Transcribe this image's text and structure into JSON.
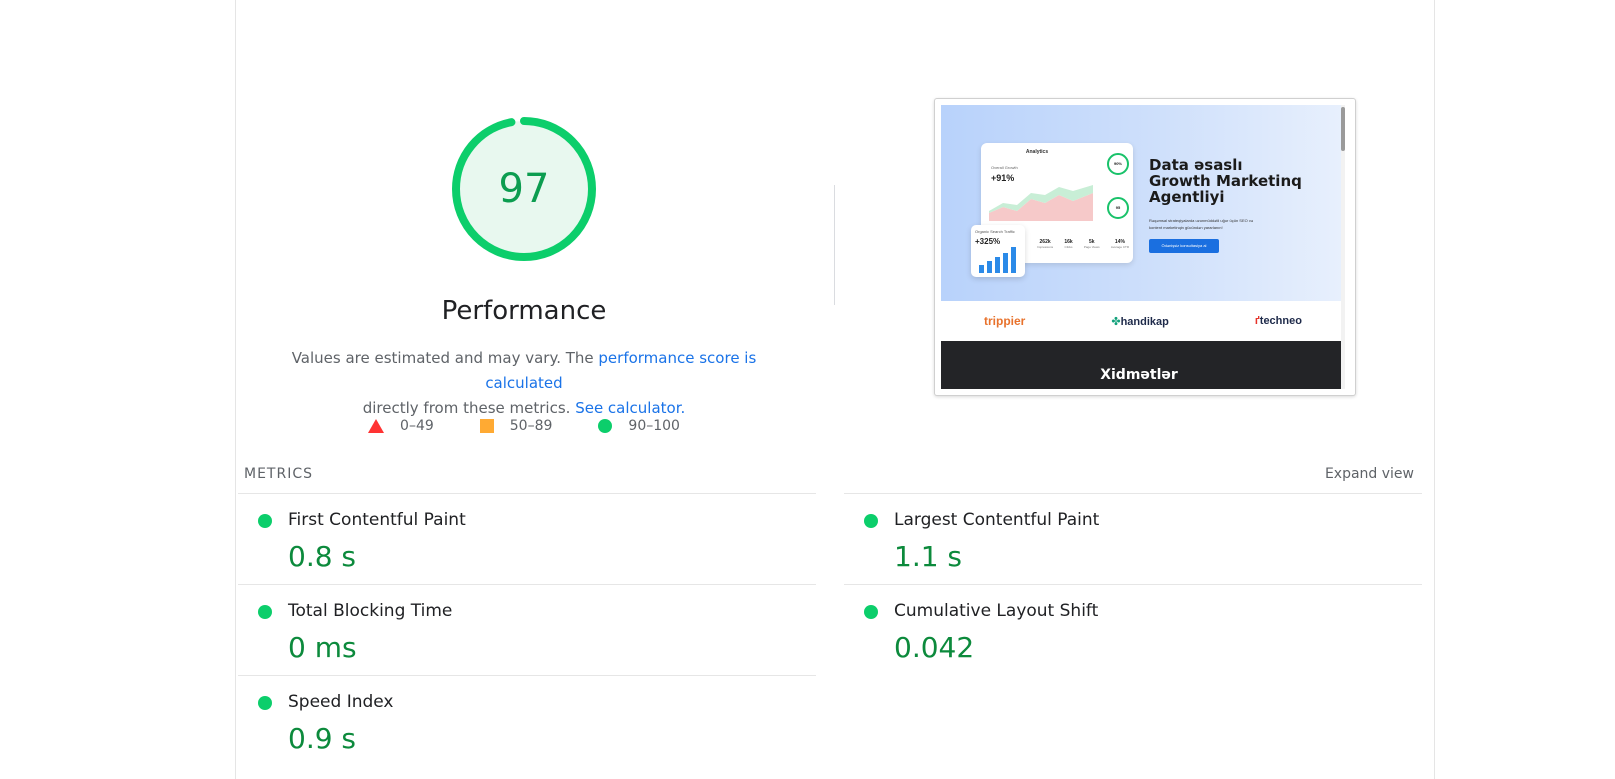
{
  "score": {
    "value": "97",
    "title": "Performance",
    "fraction": 0.97,
    "color": "#0cce6b"
  },
  "description": {
    "prefix": "Values are estimated and may vary. The ",
    "link1": "performance score is calculated",
    "middle": " directly from these metrics. ",
    "link2": "See calculator."
  },
  "legend": {
    "fail": "0–49",
    "average": "50–89",
    "pass": "90–100"
  },
  "thumbnail": {
    "card_header": "Analytics",
    "card_label": "Overall Growth",
    "card_pct": "+91%",
    "circle1": "90%",
    "circle2": "95",
    "stats": [
      {
        "value": "262k",
        "label": "Impressions"
      },
      {
        "value": "16k",
        "label": "Clicks"
      },
      {
        "value": "5k",
        "label": "Page Views"
      },
      {
        "value": "14%",
        "label": "Average CTR"
      }
    ],
    "traffic_label": "Organic Search Traffic",
    "traffic_value": "+325%",
    "hero_title_1": "Data əsaslı",
    "hero_title_2": "Growth Marketinq",
    "hero_title_3": "Agentliyi",
    "hero_sub": "Rəqəmsal strateqiyalarda uzunmüddətli uğur üçün SEO və kontent marketinqin gücündən yararlanın!",
    "hero_button": "Ödənişsiz konsultasiya al",
    "logos": [
      "trippier",
      "handikap",
      "techneo"
    ],
    "dark_title": "Xidmətlər"
  },
  "metrics": {
    "header": "METRICS",
    "expand": "Expand view",
    "items": [
      {
        "name": "First Contentful Paint",
        "value": "0.8 s"
      },
      {
        "name": "Largest Contentful Paint",
        "value": "1.1 s"
      },
      {
        "name": "Total Blocking Time",
        "value": "0 ms"
      },
      {
        "name": "Cumulative Layout Shift",
        "value": "0.042"
      },
      {
        "name": "Speed Index",
        "value": "0.9 s"
      }
    ]
  }
}
